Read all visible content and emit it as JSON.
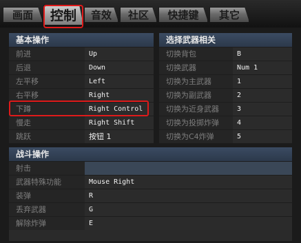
{
  "tabs": [
    {
      "label": "画面"
    },
    {
      "label": "控制"
    },
    {
      "label": "音效"
    },
    {
      "label": "社区"
    },
    {
      "label": "快捷键"
    },
    {
      "label": "其它"
    }
  ],
  "basic": {
    "title": "基本操作",
    "rows": [
      {
        "label": "前进",
        "value": "Up"
      },
      {
        "label": "后退",
        "value": "Down"
      },
      {
        "label": "左平移",
        "value": "Left"
      },
      {
        "label": "右平移",
        "value": "Right"
      },
      {
        "label": "下蹲",
        "value": "Right Control"
      },
      {
        "label": "慢走",
        "value": "Right Shift"
      },
      {
        "label": "跳跃",
        "value": "按钮 1"
      }
    ]
  },
  "weapon": {
    "title": "选择武器相关",
    "rows": [
      {
        "label": "切换背包",
        "value": "B"
      },
      {
        "label": "切换武器",
        "value": "Num 1"
      },
      {
        "label": "切换为主武器",
        "value": "1"
      },
      {
        "label": "切换为副武器",
        "value": "2"
      },
      {
        "label": "切换为近身武器",
        "value": "3"
      },
      {
        "label": "切换为投掷炸弹",
        "value": "4"
      },
      {
        "label": "切换为C4炸弹",
        "value": "5"
      }
    ]
  },
  "combat": {
    "title": "战斗操作",
    "rows": [
      {
        "label": "射击",
        "value": ""
      },
      {
        "label": "武器特殊功能",
        "value": "Mouse Right"
      },
      {
        "label": "装弹",
        "value": "R"
      },
      {
        "label": "丢弃武器",
        "value": "G"
      },
      {
        "label": "解除炸弹",
        "value": "E"
      }
    ]
  }
}
